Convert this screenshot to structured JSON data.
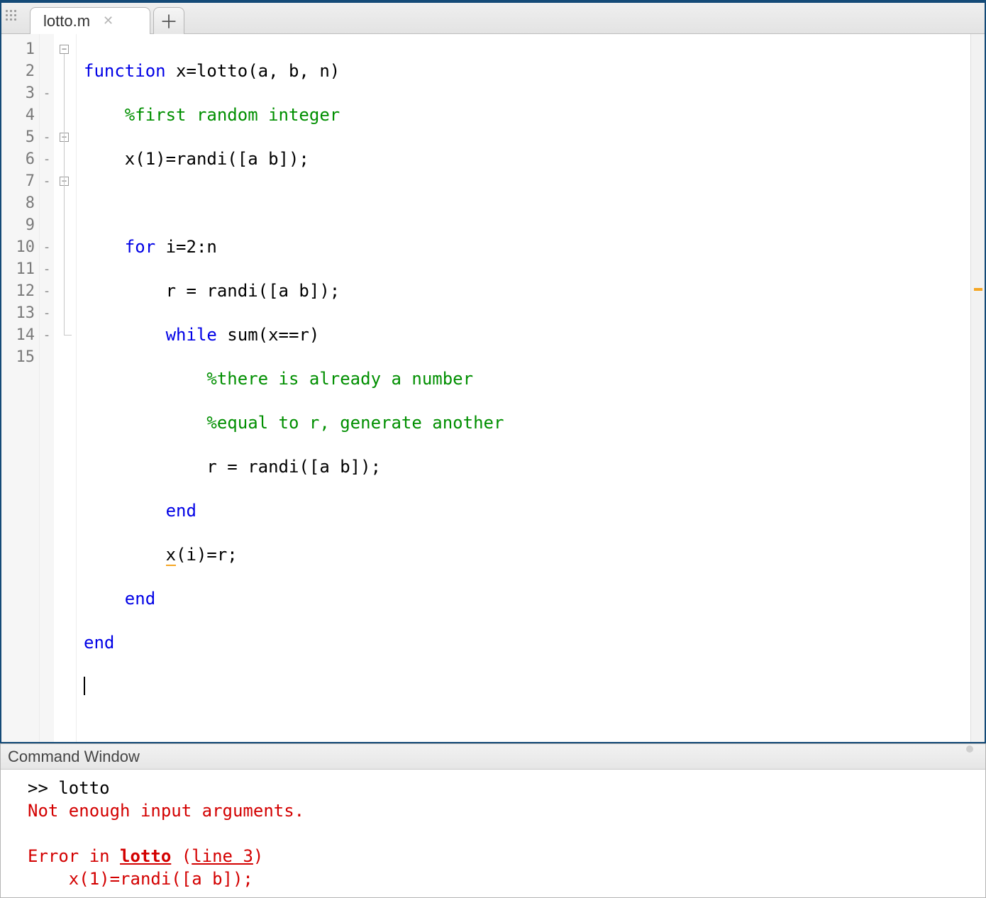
{
  "tab": {
    "filename": "lotto.m"
  },
  "editor": {
    "lineNumbers": [
      "1",
      "2",
      "3",
      "4",
      "5",
      "6",
      "7",
      "8",
      "9",
      "10",
      "11",
      "12",
      "13",
      "14",
      "15"
    ],
    "dashes": [
      "",
      "",
      "-",
      "",
      "-",
      "-",
      "-",
      "",
      "",
      "-",
      "-",
      "-",
      "-",
      "-",
      ""
    ],
    "code": {
      "l1": {
        "kw_func": "function",
        "rest": " x=lotto(a, b, n)"
      },
      "l2": {
        "cm": "%first random integer"
      },
      "l3": {
        "txt": "x(1)=randi([a b]);"
      },
      "l4": {
        "txt": ""
      },
      "l5": {
        "kw": "for",
        "rest": " i=2:n"
      },
      "l6": {
        "txt": "r = randi([a b]);"
      },
      "l7": {
        "kw": "while",
        "rest": " sum(x==r)"
      },
      "l8": {
        "cm": "%there is already a number"
      },
      "l9": {
        "cm": "%equal to r, generate another"
      },
      "l10": {
        "txt": "r = randi([a b]);"
      },
      "l11": {
        "kw": "end"
      },
      "l12": {
        "warn": "x",
        "rest": "(i)=r;"
      },
      "l13": {
        "kw": "end"
      },
      "l14": {
        "kw": "end"
      }
    }
  },
  "cw": {
    "title": "Command Window",
    "prompt": ">> ",
    "cmd": "lotto",
    "err1": "Not enough input arguments.",
    "err2a": "Error in ",
    "err2b": "lotto",
    "err2c": " (",
    "err2d": "line 3",
    "err2e": ")",
    "err3": "    x(1)=randi([a b]);"
  }
}
